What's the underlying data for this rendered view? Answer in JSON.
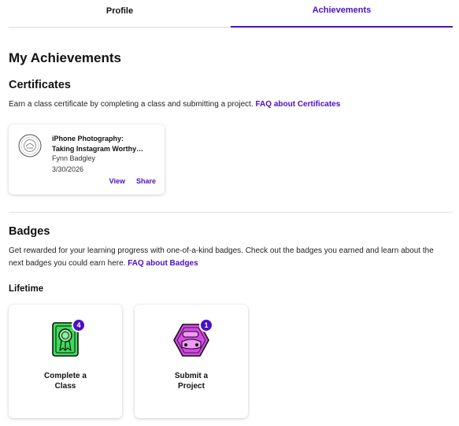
{
  "tabs": [
    {
      "label": "Profile",
      "active": false
    },
    {
      "label": "Achievements",
      "active": true
    }
  ],
  "page_title": "My Achievements",
  "certificates": {
    "heading": "Certificates",
    "description": "Earn a class certificate by completing a class and submitting a project.",
    "faq_link": "FAQ about Certificates",
    "items": [
      {
        "title_line1": "iPhone Photography:",
        "title_line2": "Taking Instagram Worthy…",
        "author": "Fynn Badgley",
        "date": "3/30/2026",
        "view_label": "View",
        "share_label": "Share"
      }
    ]
  },
  "badges": {
    "heading": "Badges",
    "description": "Get rewarded for your learning progress with one-of-a-kind badges. Check out the badges you earned and learn about the next badges you could earn here.",
    "faq_link": "FAQ about Badges",
    "lifetime_heading": "Lifetime",
    "items": [
      {
        "label": "Complete a Class",
        "count": "4",
        "icon": "ribbon-badge-icon",
        "color": "#3ddc5a"
      },
      {
        "label": "Submit a Project",
        "count": "1",
        "icon": "project-badge-icon",
        "color": "#d648e6"
      }
    ]
  },
  "colors": {
    "accent": "#4a10c8"
  }
}
